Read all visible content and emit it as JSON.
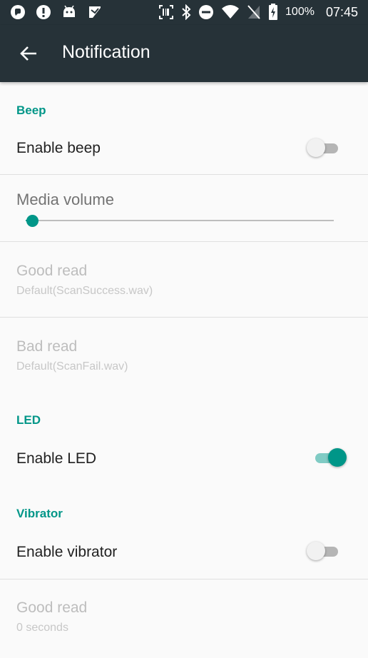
{
  "status_bar": {
    "icons": [
      "chat-bubble-icon",
      "alert-circle-icon",
      "android-icon",
      "app-icon"
    ],
    "right_icons": [
      "scanner-icon",
      "bluetooth-icon",
      "do-not-disturb-icon",
      "wifi-icon",
      "no-sim-icon",
      "battery-charging-icon"
    ],
    "battery": "100%",
    "time": "07:45"
  },
  "appbar": {
    "title": "Notification",
    "color": "#263238"
  },
  "accent": "#009688",
  "sections": {
    "beep": {
      "header": "Beep",
      "enable_label": "Enable beep",
      "enable_on": false,
      "media_volume_label": "Media volume",
      "media_volume_level": 0.02,
      "good_read_label": "Good read",
      "good_read_value": "Default(ScanSuccess.wav)",
      "bad_read_label": "Bad read",
      "bad_read_value": "Default(ScanFail.wav)"
    },
    "led": {
      "header": "LED",
      "enable_label": "Enable LED",
      "enable_on": true
    },
    "vibrator": {
      "header": "Vibrator",
      "enable_label": "Enable vibrator",
      "enable_on": false,
      "good_read_label": "Good read",
      "good_read_value": "0 seconds"
    }
  }
}
